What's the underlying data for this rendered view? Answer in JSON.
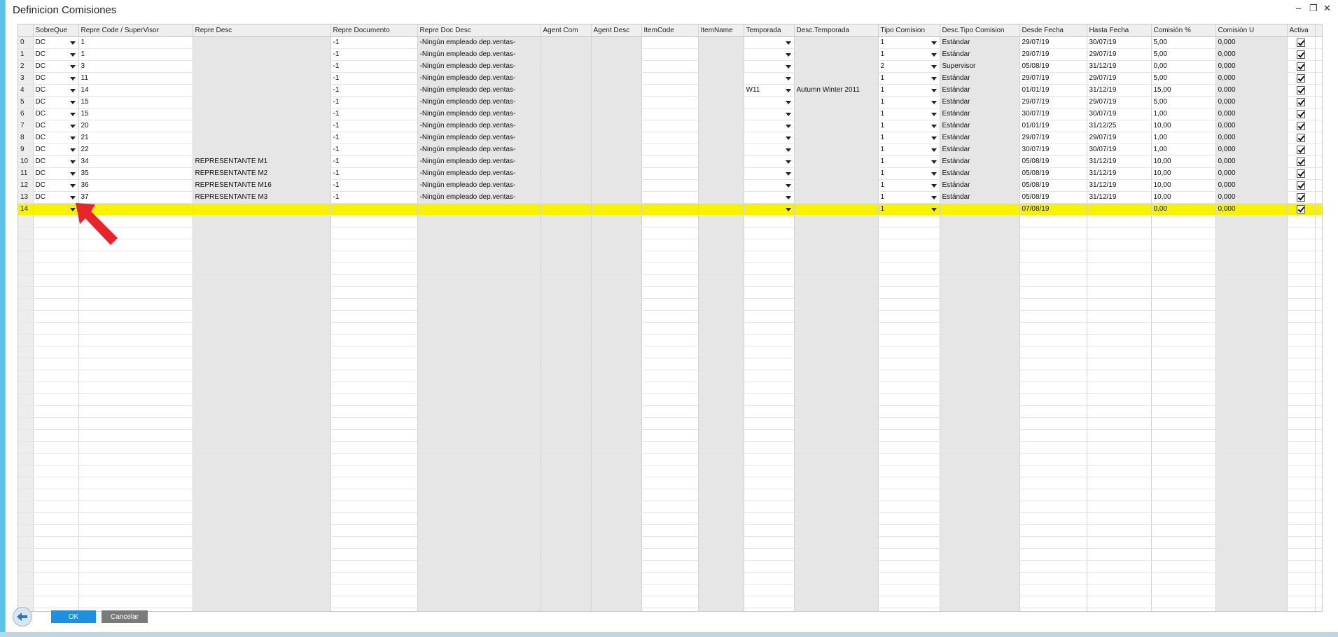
{
  "window": {
    "title": "Definicion Comisiones",
    "minimize_glyph": "–",
    "restore_glyph": "❐",
    "close_glyph": "✕"
  },
  "grid": {
    "columns": [
      "",
      "SobreQue",
      "Repre Code / SuperVisor",
      "Repre Desc",
      "Repre Documento",
      "Repre Doc Desc",
      "Agent Com",
      "Agent Desc",
      "ItemCode",
      "ItemName",
      "Temporada",
      "Desc.Temporada",
      "Tipo Comision",
      "Desc.Tipo Comision",
      "Desde Fecha",
      "Hasta Fecha",
      "Comisión %",
      "Comisión U",
      "Activa"
    ],
    "rows": [
      {
        "n": "0",
        "sq": "DC",
        "code": "1",
        "desc": "",
        "doc": "-1",
        "docdesc": "-Ningún empleado dep.ventas-",
        "agcom": "",
        "agdesc": "",
        "item": "",
        "itemname": "",
        "temp": "",
        "desctemp": "",
        "tipo": "1",
        "desctipo": "Estándar",
        "desde": "29/07/19",
        "hasta": "30/07/19",
        "pct": "5,00",
        "u": "0,000",
        "activa": true
      },
      {
        "n": "1",
        "sq": "DC",
        "code": "1",
        "desc": "",
        "doc": "-1",
        "docdesc": "-Ningún empleado dep.ventas-",
        "agcom": "",
        "agdesc": "",
        "item": "",
        "itemname": "",
        "temp": "",
        "desctemp": "",
        "tipo": "1",
        "desctipo": "Estándar",
        "desde": "29/07/19",
        "hasta": "29/07/19",
        "pct": "5,00",
        "u": "0,000",
        "activa": true
      },
      {
        "n": "2",
        "sq": "DC",
        "code": "3",
        "desc": "",
        "doc": "-1",
        "docdesc": "-Ningún empleado dep.ventas-",
        "agcom": "",
        "agdesc": "",
        "item": "",
        "itemname": "",
        "temp": "",
        "desctemp": "",
        "tipo": "2",
        "desctipo": "Supervisor",
        "desde": "05/08/19",
        "hasta": "31/12/19",
        "pct": "0,00",
        "u": "0,000",
        "activa": true
      },
      {
        "n": "3",
        "sq": "DC",
        "code": "11",
        "desc": "",
        "doc": "-1",
        "docdesc": "-Ningún empleado dep.ventas-",
        "agcom": "",
        "agdesc": "",
        "item": "",
        "itemname": "",
        "temp": "",
        "desctemp": "",
        "tipo": "1",
        "desctipo": "Estándar",
        "desde": "29/07/19",
        "hasta": "29/07/19",
        "pct": "5,00",
        "u": "0,000",
        "activa": true
      },
      {
        "n": "4",
        "sq": "DC",
        "code": "14",
        "desc": "",
        "doc": "-1",
        "docdesc": "-Ningún empleado dep.ventas-",
        "agcom": "",
        "agdesc": "",
        "item": "",
        "itemname": "",
        "temp": "W11",
        "desctemp": "Autumn Winter 2011",
        "tipo": "1",
        "desctipo": "Estándar",
        "desde": "01/01/19",
        "hasta": "31/12/19",
        "pct": "15,00",
        "u": "0,000",
        "activa": true
      },
      {
        "n": "5",
        "sq": "DC",
        "code": "15",
        "desc": "",
        "doc": "-1",
        "docdesc": "-Ningún empleado dep.ventas-",
        "agcom": "",
        "agdesc": "",
        "item": "",
        "itemname": "",
        "temp": "",
        "desctemp": "",
        "tipo": "1",
        "desctipo": "Estándar",
        "desde": "29/07/19",
        "hasta": "29/07/19",
        "pct": "5,00",
        "u": "0,000",
        "activa": true
      },
      {
        "n": "6",
        "sq": "DC",
        "code": "15",
        "desc": "",
        "doc": "-1",
        "docdesc": "-Ningún empleado dep.ventas-",
        "agcom": "",
        "agdesc": "",
        "item": "",
        "itemname": "",
        "temp": "",
        "desctemp": "",
        "tipo": "1",
        "desctipo": "Estándar",
        "desde": "30/07/19",
        "hasta": "30/07/19",
        "pct": "1,00",
        "u": "0,000",
        "activa": true
      },
      {
        "n": "7",
        "sq": "DC",
        "code": "20",
        "desc": "",
        "doc": "-1",
        "docdesc": "-Ningún empleado dep.ventas-",
        "agcom": "",
        "agdesc": "",
        "item": "",
        "itemname": "",
        "temp": "",
        "desctemp": "",
        "tipo": "1",
        "desctipo": "Estándar",
        "desde": "01/01/19",
        "hasta": "31/12/25",
        "pct": "10,00",
        "u": "0,000",
        "activa": true
      },
      {
        "n": "8",
        "sq": "DC",
        "code": "21",
        "desc": "",
        "doc": "-1",
        "docdesc": "-Ningún empleado dep.ventas-",
        "agcom": "",
        "agdesc": "",
        "item": "",
        "itemname": "",
        "temp": "",
        "desctemp": "",
        "tipo": "1",
        "desctipo": "Estándar",
        "desde": "29/07/19",
        "hasta": "29/07/19",
        "pct": "1,00",
        "u": "0,000",
        "activa": true
      },
      {
        "n": "9",
        "sq": "DC",
        "code": "22",
        "desc": "",
        "doc": "-1",
        "docdesc": "-Ningún empleado dep.ventas-",
        "agcom": "",
        "agdesc": "",
        "item": "",
        "itemname": "",
        "temp": "",
        "desctemp": "",
        "tipo": "1",
        "desctipo": "Estándar",
        "desde": "30/07/19",
        "hasta": "30/07/19",
        "pct": "1,00",
        "u": "0,000",
        "activa": true
      },
      {
        "n": "10",
        "sq": "DC",
        "code": "34",
        "desc": "REPRESENTANTE M1",
        "doc": "-1",
        "docdesc": "-Ningún empleado dep.ventas-",
        "agcom": "",
        "agdesc": "",
        "item": "",
        "itemname": "",
        "temp": "",
        "desctemp": "",
        "tipo": "1",
        "desctipo": "Estándar",
        "desde": "05/08/19",
        "hasta": "31/12/19",
        "pct": "10,00",
        "u": "0,000",
        "activa": true
      },
      {
        "n": "11",
        "sq": "DC",
        "code": "35",
        "desc": "REPRESENTANTE M2",
        "doc": "-1",
        "docdesc": "-Ningún empleado dep.ventas-",
        "agcom": "",
        "agdesc": "",
        "item": "",
        "itemname": "",
        "temp": "",
        "desctemp": "",
        "tipo": "1",
        "desctipo": "Estándar",
        "desde": "05/08/19",
        "hasta": "31/12/19",
        "pct": "10,00",
        "u": "0,000",
        "activa": true
      },
      {
        "n": "12",
        "sq": "DC",
        "code": "36",
        "desc": "REPRESENTANTE M16",
        "doc": "-1",
        "docdesc": "-Ningún empleado dep.ventas-",
        "agcom": "",
        "agdesc": "",
        "item": "",
        "itemname": "",
        "temp": "",
        "desctemp": "",
        "tipo": "1",
        "desctipo": "Estándar",
        "desde": "05/08/19",
        "hasta": "31/12/19",
        "pct": "10,00",
        "u": "0,000",
        "activa": true
      },
      {
        "n": "13",
        "sq": "DC",
        "code": "37",
        "desc": "REPRESENTANTE M3",
        "doc": "-1",
        "docdesc": "-Ningún empleado dep.ventas-",
        "agcom": "",
        "agdesc": "",
        "item": "",
        "itemname": "",
        "temp": "",
        "desctemp": "",
        "tipo": "1",
        "desctipo": "Estándar",
        "desde": "05/08/19",
        "hasta": "31/12/19",
        "pct": "10,00",
        "u": "0,000",
        "activa": true
      },
      {
        "n": "14",
        "sq": "",
        "code": "",
        "desc": "",
        "doc": "",
        "docdesc": "",
        "agcom": "",
        "agdesc": "",
        "item": "",
        "itemname": "",
        "temp": "",
        "desctemp": "",
        "tipo": "1",
        "desctipo": "",
        "desde": "07/08/19",
        "hasta": "",
        "pct": "0,00",
        "u": "0,000",
        "activa": true,
        "selected": true
      }
    ]
  },
  "footer": {
    "ok_label": "OK",
    "cancel_label": "Cancelar"
  },
  "colors": {
    "selected_row": "#f7f300",
    "ok_button": "#1e90e0",
    "cancel_button": "#7a7a7a",
    "annotation_arrow": "#e8232a"
  }
}
